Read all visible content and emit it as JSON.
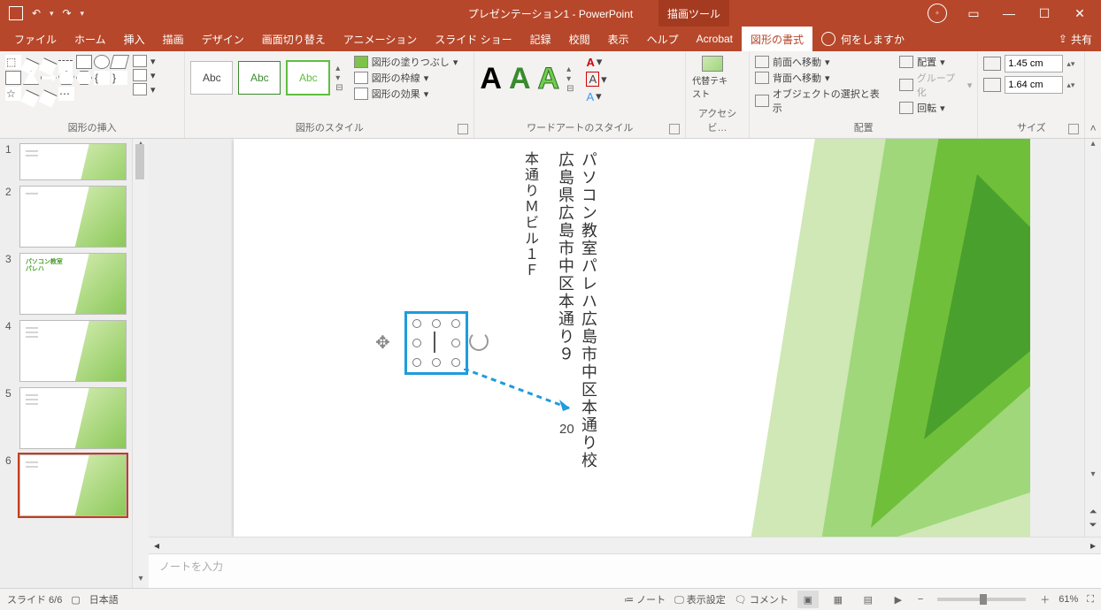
{
  "title": "プレゼンテーション1 - PowerPoint",
  "tool_tab": "描画ツール",
  "tabs": [
    "ファイル",
    "ホーム",
    "挿入",
    "描画",
    "デザイン",
    "画面切り替え",
    "アニメーション",
    "スライド ショー",
    "記録",
    "校閲",
    "表示",
    "ヘルプ",
    "Acrobat",
    "図形の書式"
  ],
  "active_tab": "図形の書式",
  "tell_me": "何をしますか",
  "share": "共有",
  "ribbon": {
    "g1_label": "図形の挿入",
    "g2_label": "図形のスタイル",
    "g2_sample": "Abc",
    "fill": "図形の塗りつぶし",
    "outline": "図形の枠線",
    "effects": "図形の効果",
    "g3_label": "ワードアートのスタイル",
    "wa_letter": "A",
    "alt_label": "代替テキスト",
    "g4_label": "アクセシビ…",
    "front": "前面へ移動",
    "back": "背面へ移動",
    "selpane": "オブジェクトの選択と表示",
    "align": "配置",
    "group": "グループ化",
    "rotate": "回転",
    "g5_label": "配置",
    "height": "1.45 cm",
    "width": "1.64 cm",
    "g6_label": "サイズ"
  },
  "thumbs": [
    1,
    2,
    3,
    4,
    5,
    6
  ],
  "current_thumb": 6,
  "slide_text": {
    "line1": "パソコン教室パレハ広島市中区本通り校",
    "line2": "広島県広島市中区本通り９",
    "line3": "本通りＭビル１Ｆ",
    "num": "20"
  },
  "notes_placeholder": "ノートを入力",
  "status": {
    "slide": "スライド 6/6",
    "lang": "日本語",
    "notes": "ノート",
    "display": "表示設定",
    "comments": "コメント",
    "zoom": "61%"
  }
}
